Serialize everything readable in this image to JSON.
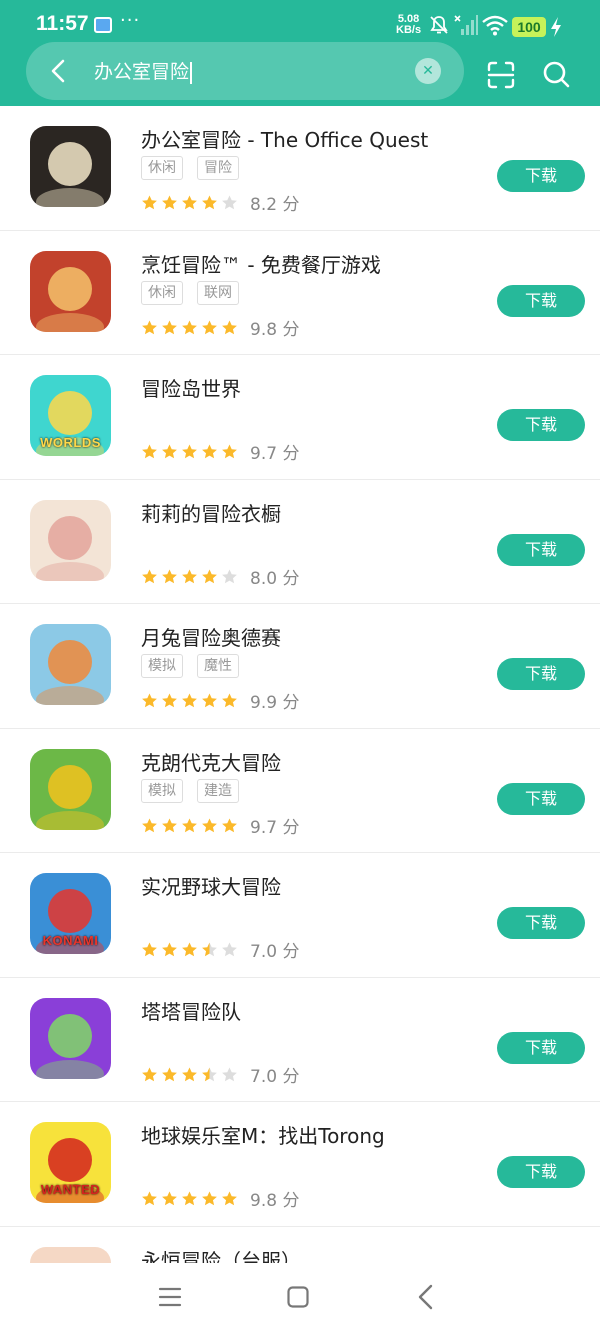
{
  "status": {
    "time": "11:57",
    "dots": "···",
    "net_speed": "5.08",
    "net_unit": "KB/s",
    "battery": "100"
  },
  "search": {
    "query": "办公室冒险"
  },
  "colors": {
    "accent": "#26b99a",
    "star_filled": "#fbb92a",
    "star_empty": "#dddddd"
  },
  "apps": [
    {
      "name": "办公室冒险 - The Office Quest",
      "tags": [
        "休闲",
        "冒险"
      ],
      "stars": 4,
      "score": "8.2 分",
      "download": "下载"
    },
    {
      "name": "烹饪冒险™ - 免费餐厅游戏",
      "tags": [
        "休闲",
        "联网"
      ],
      "stars": 5,
      "score": "9.8 分",
      "download": "下载"
    },
    {
      "name": "冒险岛世界",
      "tags": [],
      "stars": 5,
      "score": "9.7 分",
      "download": "下载"
    },
    {
      "name": "莉莉的冒险衣橱",
      "tags": [],
      "stars": 4,
      "score": "8.0 分",
      "download": "下载"
    },
    {
      "name": "月兔冒险奥德赛",
      "tags": [
        "模拟",
        "魔性"
      ],
      "stars": 5,
      "score": "9.9 分",
      "download": "下载"
    },
    {
      "name": "克朗代克大冒险",
      "tags": [
        "模拟",
        "建造"
      ],
      "stars": 5,
      "score": "9.7 分",
      "download": "下载"
    },
    {
      "name": "实况野球大冒险",
      "tags": [],
      "stars": 3.5,
      "score": "7.0 分",
      "download": "下载"
    },
    {
      "name": "塔塔冒险队",
      "tags": [],
      "stars": 3.5,
      "score": "7.0 分",
      "download": "下载"
    },
    {
      "name": "地球娱乐室M：找出Torong",
      "tags": [],
      "stars": 5,
      "score": "9.8 分",
      "download": "下载"
    },
    {
      "name": "永恒冒险（台服）",
      "tags": [],
      "stars": 0,
      "score": "",
      "download": ""
    }
  ],
  "icon_art": [
    {
      "label": "",
      "bg": "#2b2622",
      "fg": "#f2e6c8"
    },
    {
      "label": "",
      "bg": "#c2422c",
      "fg": "#f5c16b"
    },
    {
      "label": "WORLDS",
      "bg": "#3fd6cf",
      "fg": "#ffd84a"
    },
    {
      "label": "",
      "bg": "#f3e4d6",
      "fg": "#e3a59b"
    },
    {
      "label": "",
      "bg": "#8cc9e6",
      "fg": "#f08a3a"
    },
    {
      "label": "",
      "bg": "#6cb847",
      "fg": "#f2c21d"
    },
    {
      "label": "KONAMI",
      "bg": "#3a8fd6",
      "fg": "#e8352b"
    },
    {
      "label": "",
      "bg": "#8a3fd8",
      "fg": "#7fd866"
    },
    {
      "label": "WANTED",
      "bg": "#f7e23b",
      "fg": "#d3231f"
    },
    {
      "label": "",
      "bg": "#f5d8c5",
      "fg": "#eab59a"
    }
  ]
}
